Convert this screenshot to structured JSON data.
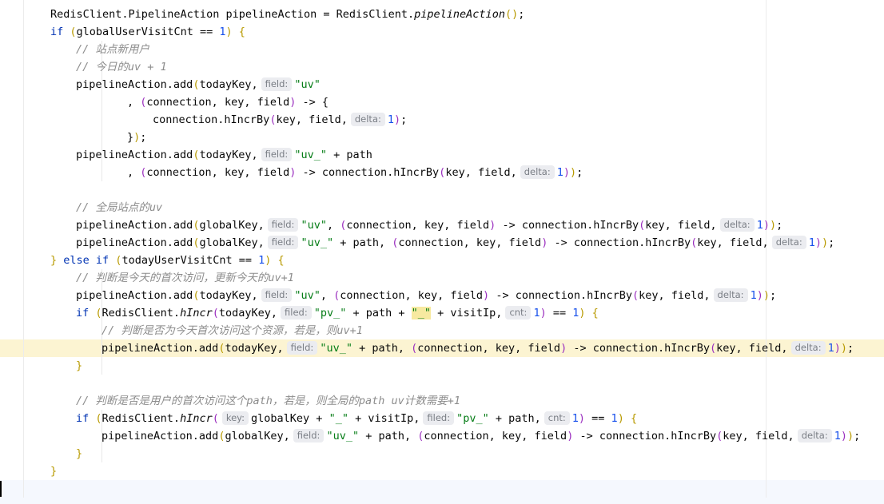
{
  "editor": {
    "colors": {
      "keyword": "#0033b3",
      "string": "#067d17",
      "number": "#1750eb",
      "comment": "#8c8c8c",
      "text": "#080808",
      "bracket_level_1": "#b89a00",
      "bracket_level_2": "#9b2fbf",
      "bracket_level_3": "#1f8a4c",
      "hint_background": "#ebecf0",
      "hint_text": "#7a7e85",
      "current_line_background": "#f5f8fe",
      "highlighted_line_background": "#fcf4d2",
      "matched_token_background": "#f7e9a0"
    },
    "lines": [
      {
        "indent": 1,
        "tokens": [
          {
            "t": "RedisClient.PipelineAction pipelineAction = RedisClient.",
            "c": "pl"
          },
          {
            "t": "pipelineAction",
            "c": "it"
          },
          {
            "t": "()",
            "c": "br1"
          },
          {
            "t": ";",
            "c": "pl"
          }
        ]
      },
      {
        "indent": 1,
        "tokens": [
          {
            "t": "if ",
            "c": "kw"
          },
          {
            "t": "(",
            "c": "br1"
          },
          {
            "t": "globalUserVisitCnt == ",
            "c": "pl"
          },
          {
            "t": "1",
            "c": "num"
          },
          {
            "t": ") {",
            "c": "br1"
          }
        ]
      },
      {
        "indent": 2,
        "tokens": [
          {
            "t": "// 站点新用户",
            "c": "cmt"
          }
        ]
      },
      {
        "indent": 2,
        "tokens": [
          {
            "t": "// 今日的uv + 1",
            "c": "cmt"
          }
        ]
      },
      {
        "indent": 2,
        "tokens": [
          {
            "t": "pipelineAction.add",
            "c": "pl"
          },
          {
            "t": "(",
            "c": "br1"
          },
          {
            "t": "todayKey,",
            "c": "pl"
          },
          {
            "t": "field:",
            "c": "hint"
          },
          {
            "t": "\"uv\"",
            "c": "str"
          }
        ]
      },
      {
        "indent": 4,
        "tokens": [
          {
            "t": ", ",
            "c": "pl"
          },
          {
            "t": "(",
            "c": "br2"
          },
          {
            "t": "connection, key, field",
            "c": "pl"
          },
          {
            "t": ")",
            "c": "br2"
          },
          {
            "t": " -> {",
            "c": "pl"
          }
        ]
      },
      {
        "indent": 5,
        "tokens": [
          {
            "t": "connection.hIncrBy",
            "c": "pl"
          },
          {
            "t": "(",
            "c": "br2"
          },
          {
            "t": "key, field,",
            "c": "pl"
          },
          {
            "t": "delta:",
            "c": "hint"
          },
          {
            "t": "1",
            "c": "num"
          },
          {
            "t": ")",
            "c": "br2"
          },
          {
            "t": ";",
            "c": "pl"
          }
        ]
      },
      {
        "indent": 4,
        "tokens": [
          {
            "t": "}",
            "c": "pl"
          },
          {
            "t": ")",
            "c": "br1"
          },
          {
            "t": ";",
            "c": "pl"
          }
        ]
      },
      {
        "indent": 2,
        "tokens": [
          {
            "t": "pipelineAction.add",
            "c": "pl"
          },
          {
            "t": "(",
            "c": "br1"
          },
          {
            "t": "todayKey,",
            "c": "pl"
          },
          {
            "t": "field:",
            "c": "hint"
          },
          {
            "t": "\"uv_\"",
            "c": "str"
          },
          {
            "t": " + path",
            "c": "pl"
          }
        ]
      },
      {
        "indent": 4,
        "tokens": [
          {
            "t": ", ",
            "c": "pl"
          },
          {
            "t": "(",
            "c": "br2"
          },
          {
            "t": "connection, key, field",
            "c": "pl"
          },
          {
            "t": ")",
            "c": "br2"
          },
          {
            "t": " -> connection.hIncrBy",
            "c": "pl"
          },
          {
            "t": "(",
            "c": "br2"
          },
          {
            "t": "key, field,",
            "c": "pl"
          },
          {
            "t": "delta:",
            "c": "hint"
          },
          {
            "t": "1",
            "c": "num"
          },
          {
            "t": ")",
            "c": "br2"
          },
          {
            "t": ")",
            "c": "br1"
          },
          {
            "t": ";",
            "c": "pl"
          }
        ]
      },
      {
        "indent": 0,
        "tokens": []
      },
      {
        "indent": 2,
        "tokens": [
          {
            "t": "// 全局站点的uv",
            "c": "cmt"
          }
        ]
      },
      {
        "indent": 2,
        "tokens": [
          {
            "t": "pipelineAction.add",
            "c": "pl"
          },
          {
            "t": "(",
            "c": "br1"
          },
          {
            "t": "globalKey,",
            "c": "pl"
          },
          {
            "t": "field:",
            "c": "hint"
          },
          {
            "t": "\"uv\"",
            "c": "str"
          },
          {
            "t": ", ",
            "c": "pl"
          },
          {
            "t": "(",
            "c": "br2"
          },
          {
            "t": "connection, key, field",
            "c": "pl"
          },
          {
            "t": ")",
            "c": "br2"
          },
          {
            "t": " -> connection.hIncrBy",
            "c": "pl"
          },
          {
            "t": "(",
            "c": "br2"
          },
          {
            "t": "key, field,",
            "c": "pl"
          },
          {
            "t": "delta:",
            "c": "hint"
          },
          {
            "t": "1",
            "c": "num"
          },
          {
            "t": ")",
            "c": "br2"
          },
          {
            "t": ")",
            "c": "br1"
          },
          {
            "t": ";",
            "c": "pl"
          }
        ]
      },
      {
        "indent": 2,
        "tokens": [
          {
            "t": "pipelineAction.add",
            "c": "pl"
          },
          {
            "t": "(",
            "c": "br1"
          },
          {
            "t": "globalKey,",
            "c": "pl"
          },
          {
            "t": "field:",
            "c": "hint"
          },
          {
            "t": "\"uv_\"",
            "c": "str"
          },
          {
            "t": " + path, ",
            "c": "pl"
          },
          {
            "t": "(",
            "c": "br2"
          },
          {
            "t": "connection, key, field",
            "c": "pl"
          },
          {
            "t": ")",
            "c": "br2"
          },
          {
            "t": " -> connection.hIncrBy",
            "c": "pl"
          },
          {
            "t": "(",
            "c": "br2"
          },
          {
            "t": "key, field,",
            "c": "pl"
          },
          {
            "t": "delta:",
            "c": "hint"
          },
          {
            "t": "1",
            "c": "num"
          },
          {
            "t": ")",
            "c": "br2"
          },
          {
            "t": ")",
            "c": "br1"
          },
          {
            "t": ";",
            "c": "pl"
          }
        ]
      },
      {
        "indent": 1,
        "tokens": [
          {
            "t": "} ",
            "c": "br1"
          },
          {
            "t": "else if ",
            "c": "kw"
          },
          {
            "t": "(",
            "c": "br1"
          },
          {
            "t": "todayUserVisitCnt == ",
            "c": "pl"
          },
          {
            "t": "1",
            "c": "num"
          },
          {
            "t": ") {",
            "c": "br1"
          }
        ]
      },
      {
        "indent": 2,
        "tokens": [
          {
            "t": "// 判断是今天的首次访问，更新今天的uv+1",
            "c": "cmt"
          }
        ]
      },
      {
        "indent": 2,
        "tokens": [
          {
            "t": "pipelineAction.add",
            "c": "pl"
          },
          {
            "t": "(",
            "c": "br1"
          },
          {
            "t": "todayKey,",
            "c": "pl"
          },
          {
            "t": "field:",
            "c": "hint"
          },
          {
            "t": "\"uv\"",
            "c": "str"
          },
          {
            "t": ", ",
            "c": "pl"
          },
          {
            "t": "(",
            "c": "br2"
          },
          {
            "t": "connection, key, field",
            "c": "pl"
          },
          {
            "t": ")",
            "c": "br2"
          },
          {
            "t": " -> connection.hIncrBy",
            "c": "pl"
          },
          {
            "t": "(",
            "c": "br2"
          },
          {
            "t": "key, field,",
            "c": "pl"
          },
          {
            "t": "delta:",
            "c": "hint"
          },
          {
            "t": "1",
            "c": "num"
          },
          {
            "t": ")",
            "c": "br2"
          },
          {
            "t": ")",
            "c": "br1"
          },
          {
            "t": ";",
            "c": "pl"
          }
        ]
      },
      {
        "indent": 2,
        "tokens": [
          {
            "t": "if ",
            "c": "kw"
          },
          {
            "t": "(",
            "c": "br1"
          },
          {
            "t": "RedisClient.",
            "c": "pl"
          },
          {
            "t": "hIncr",
            "c": "it"
          },
          {
            "t": "(",
            "c": "br2"
          },
          {
            "t": "todayKey,",
            "c": "pl"
          },
          {
            "t": "filed:",
            "c": "hint"
          },
          {
            "t": "\"pv_\"",
            "c": "str"
          },
          {
            "t": " + path + ",
            "c": "pl"
          },
          {
            "t": "\"_\"",
            "c": "strmatch"
          },
          {
            "t": " + visitIp,",
            "c": "pl"
          },
          {
            "t": "cnt:",
            "c": "hint"
          },
          {
            "t": "1",
            "c": "num"
          },
          {
            "t": ")",
            "c": "br2"
          },
          {
            "t": " == ",
            "c": "pl"
          },
          {
            "t": "1",
            "c": "num"
          },
          {
            "t": ") {",
            "c": "br1"
          }
        ]
      },
      {
        "indent": 3,
        "tokens": [
          {
            "t": "// 判断是否为今天首次访问这个资源，若是，则uv+1",
            "c": "cmt"
          }
        ]
      },
      {
        "indent": 3,
        "tokens": [
          {
            "t": "pipelineAction.add",
            "c": "pl"
          },
          {
            "t": "(",
            "c": "br1"
          },
          {
            "t": "todayKey,",
            "c": "pl"
          },
          {
            "t": "field:",
            "c": "hint"
          },
          {
            "t": "\"uv_\"",
            "c": "str"
          },
          {
            "t": " + path, ",
            "c": "pl"
          },
          {
            "t": "(",
            "c": "br2"
          },
          {
            "t": "connection, key, field",
            "c": "pl"
          },
          {
            "t": ")",
            "c": "br2"
          },
          {
            "t": " -> connection.hIncrBy",
            "c": "pl"
          },
          {
            "t": "(",
            "c": "br2"
          },
          {
            "t": "key, field,",
            "c": "pl"
          },
          {
            "t": "delta:",
            "c": "hint"
          },
          {
            "t": "1",
            "c": "num"
          },
          {
            "t": ")",
            "c": "br2"
          },
          {
            "t": ")",
            "c": "br1"
          },
          {
            "t": ";",
            "c": "pl"
          }
        ]
      },
      {
        "indent": 2,
        "tokens": [
          {
            "t": "}",
            "c": "br1"
          }
        ]
      },
      {
        "indent": 0,
        "tokens": []
      },
      {
        "indent": 2,
        "tokens": [
          {
            "t": "// 判断是否是用户的首次访问这个path，若是，则全局的path uv计数需要+1",
            "c": "cmt"
          }
        ]
      },
      {
        "indent": 2,
        "tokens": [
          {
            "t": "if ",
            "c": "kw"
          },
          {
            "t": "(",
            "c": "br1"
          },
          {
            "t": "RedisClient.",
            "c": "pl"
          },
          {
            "t": "hIncr",
            "c": "it"
          },
          {
            "t": "(",
            "c": "br2"
          },
          {
            "t": "key:",
            "c": "hint"
          },
          {
            "t": "globalKey + ",
            "c": "pl"
          },
          {
            "t": "\"_\"",
            "c": "str"
          },
          {
            "t": " + visitIp,",
            "c": "pl"
          },
          {
            "t": "filed:",
            "c": "hint"
          },
          {
            "t": "\"pv_\"",
            "c": "str"
          },
          {
            "t": " + path,",
            "c": "pl"
          },
          {
            "t": "cnt:",
            "c": "hint"
          },
          {
            "t": "1",
            "c": "num"
          },
          {
            "t": ")",
            "c": "br2"
          },
          {
            "t": " == ",
            "c": "pl"
          },
          {
            "t": "1",
            "c": "num"
          },
          {
            "t": ") {",
            "c": "br1"
          }
        ]
      },
      {
        "indent": 3,
        "tokens": [
          {
            "t": "pipelineAction.add",
            "c": "pl"
          },
          {
            "t": "(",
            "c": "br1"
          },
          {
            "t": "globalKey,",
            "c": "pl"
          },
          {
            "t": "field:",
            "c": "hint"
          },
          {
            "t": "\"uv_\"",
            "c": "str"
          },
          {
            "t": " + path, ",
            "c": "pl"
          },
          {
            "t": "(",
            "c": "br2"
          },
          {
            "t": "connection, key, field",
            "c": "pl"
          },
          {
            "t": ")",
            "c": "br2"
          },
          {
            "t": " -> connection.hIncrBy",
            "c": "pl"
          },
          {
            "t": "(",
            "c": "br2"
          },
          {
            "t": "key, field,",
            "c": "pl"
          },
          {
            "t": "delta:",
            "c": "hint"
          },
          {
            "t": "1",
            "c": "num"
          },
          {
            "t": ")",
            "c": "br2"
          },
          {
            "t": ")",
            "c": "br1"
          },
          {
            "t": ";",
            "c": "pl"
          }
        ]
      },
      {
        "indent": 2,
        "tokens": [
          {
            "t": "}",
            "c": "br1"
          }
        ]
      },
      {
        "indent": 1,
        "tokens": [
          {
            "t": "}",
            "c": "br1"
          }
        ]
      }
    ]
  }
}
